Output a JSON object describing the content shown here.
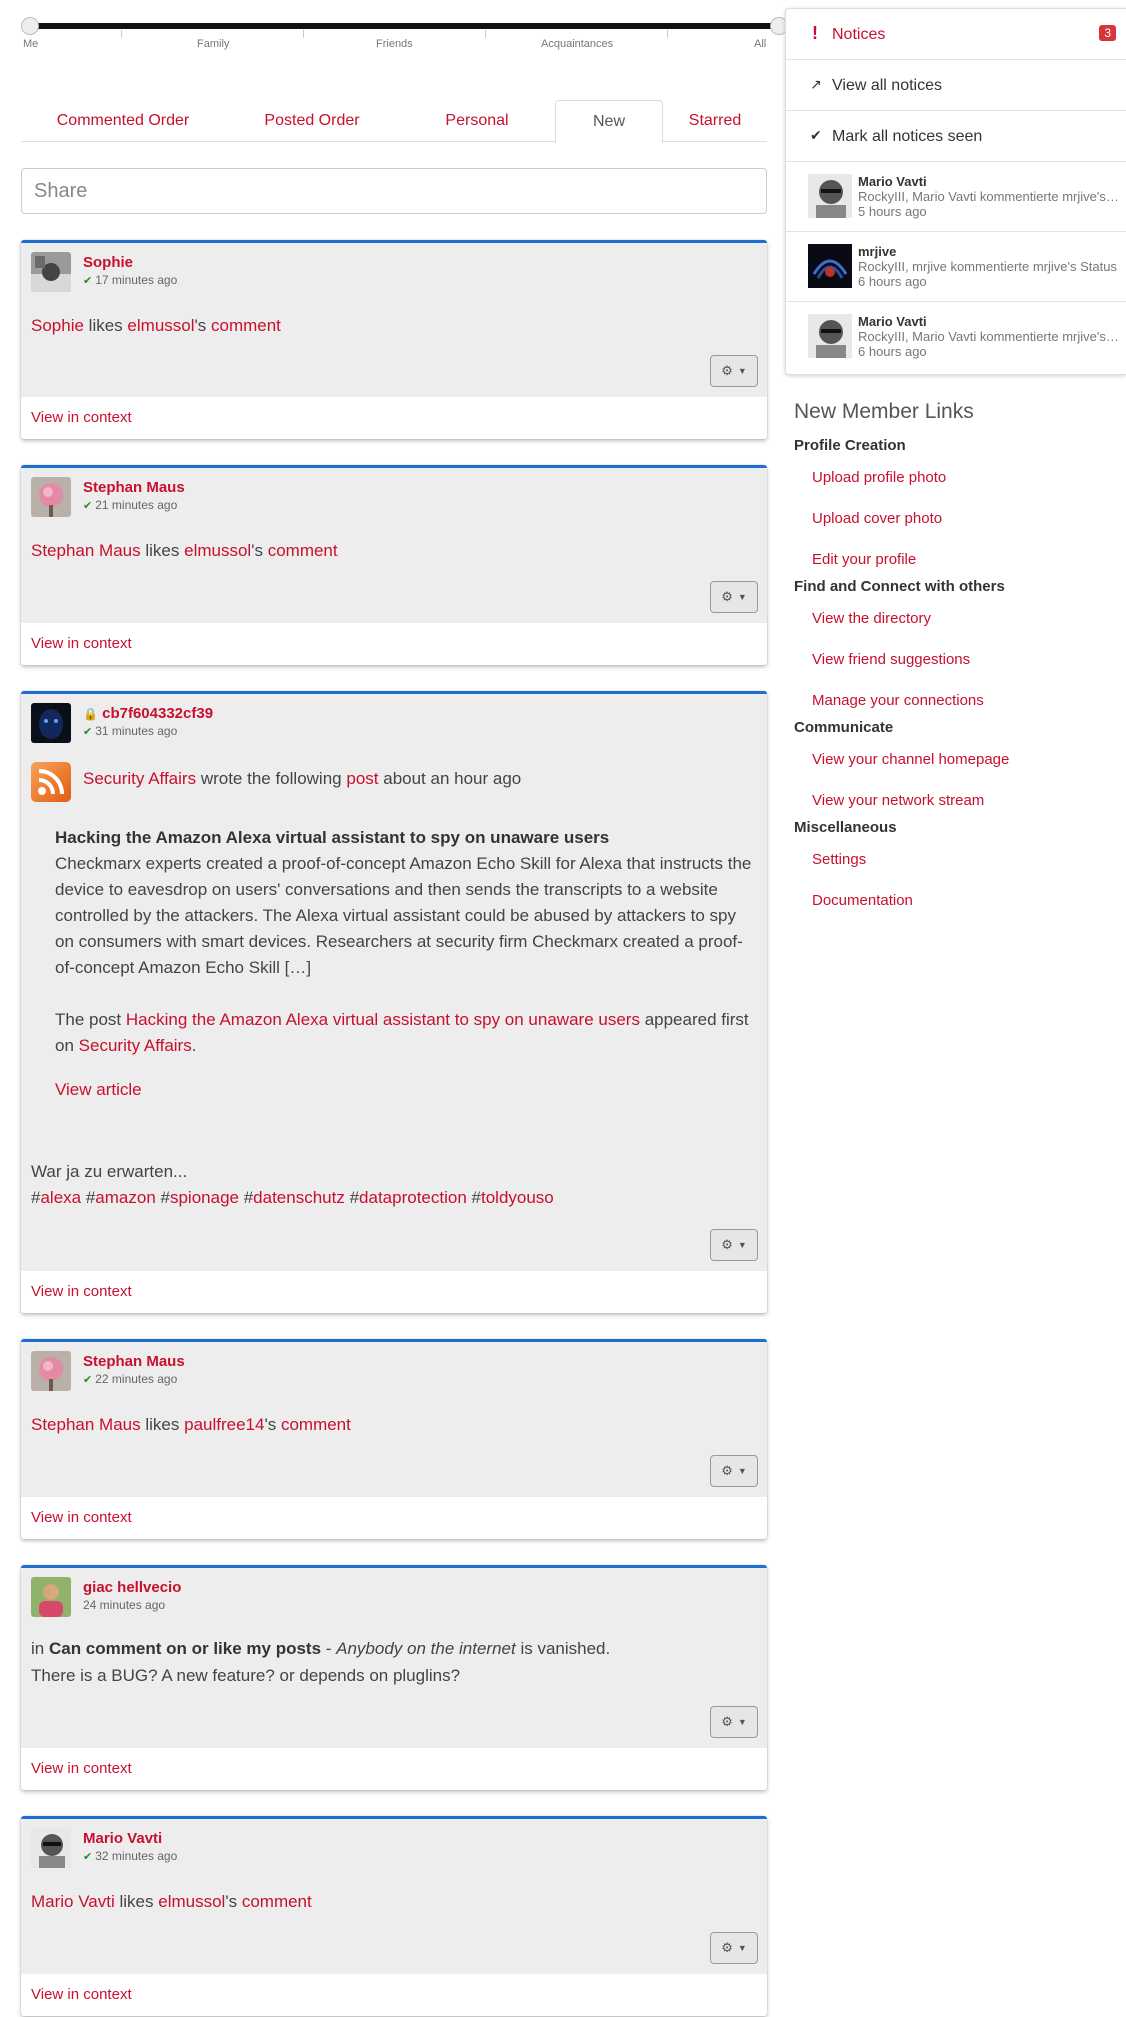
{
  "slider": {
    "labels": [
      "Me",
      "Family",
      "Friends",
      "Acquaintances",
      "All"
    ]
  },
  "tabs": [
    {
      "label": "Commented Order"
    },
    {
      "label": "Posted Order"
    },
    {
      "label": "Personal"
    },
    {
      "label": "New",
      "active": true
    },
    {
      "label": "Starred"
    }
  ],
  "share": {
    "placeholder": "Share"
  },
  "posts": {
    "p1": {
      "author": "Sophie",
      "time": "17 minutes ago",
      "actor": "Sophie",
      "verb": "likes",
      "target": "elmussol",
      "possessive": "'s",
      "object": "comment",
      "view_context": "View in context"
    },
    "p2": {
      "author": "Stephan Maus",
      "time": "21 minutes ago",
      "actor": "Stephan Maus",
      "verb": "likes",
      "target": "elmussol",
      "possessive": "'s",
      "object": "comment",
      "view_context": "View in context"
    },
    "p3": {
      "author": "cb7f604332cf39",
      "time": "31 minutes ago",
      "feed_source": "Security Affairs",
      "feed_mid": "wrote the following",
      "feed_post": "post",
      "feed_when": "about an hour ago",
      "headline": "Hacking the Amazon Alexa virtual assistant to spy on unaware users",
      "summary": "Checkmarx experts created a proof-of-concept Amazon Echo Skill for Alexa that instructs the device to eavesdrop on users' conversations and then sends the transcripts to a website controlled by the attackers. The Alexa virtual assistant could be abused by attackers to spy on consumers with smart devices. Researchers at security firm Checkmarx created a proof-of-concept Amazon Echo Skill […]",
      "the_post": "The post",
      "appeared": "appeared first on",
      "source_end": "Security Affairs",
      "view_article": "View article",
      "comment": "War ja zu erwarten...",
      "hashtags": [
        "alexa",
        "amazon",
        "spionage",
        "datenschutz",
        "dataprotection",
        "toldyouso"
      ],
      "view_context": "View in context"
    },
    "p4": {
      "author": "Stephan Maus",
      "time": "22 minutes ago",
      "actor": "Stephan Maus",
      "verb": "likes",
      "target": "paulfree14",
      "possessive": "'s",
      "object": "comment",
      "view_context": "View in context"
    },
    "p5": {
      "author": "giac hellvecio",
      "time": "24 minutes ago",
      "in": "in",
      "bold": "Can comment on or like my posts",
      "dash": " - ",
      "italic": "Anybody on the internet",
      "rest": "is vanished.",
      "line2": "There is a BUG? A new feature? or depends on pluglins?",
      "view_context": "View in context"
    },
    "p6": {
      "author": "Mario Vavti",
      "time": "32 minutes ago",
      "actor": "Mario Vavti",
      "verb": "likes",
      "target": "elmussol",
      "possessive": "'s",
      "object": "comment",
      "view_context": "View in context"
    }
  },
  "notices": {
    "title": "Notices",
    "count": "3",
    "view_all": "View all notices",
    "mark_seen": "Mark all notices seen",
    "items": [
      {
        "name": "Mario Vavti",
        "text": "RockyIII, Mario Vavti kommentierte mrjive's Status",
        "time": "5 hours ago"
      },
      {
        "name": "mrjive",
        "text": "RockyIII, mrjive kommentierte mrjive's Status",
        "time": "6 hours ago"
      },
      {
        "name": "Mario Vavti",
        "text": "RockyIII, Mario Vavti kommentierte mrjive's Status",
        "time": "6 hours ago"
      }
    ]
  },
  "member_links": {
    "title": "New Member Links",
    "cat1": "Profile Creation",
    "upload_photo": "Upload profile photo",
    "upload_cover": "Upload cover photo",
    "edit_profile": "Edit your profile",
    "cat2": "Find and Connect with others",
    "directory": "View the directory",
    "suggestions": "View friend suggestions",
    "connections": "Manage your connections",
    "cat3": "Communicate",
    "channel_home": "View your channel homepage",
    "network_stream": "View your network stream",
    "cat4": "Miscellaneous",
    "settings": "Settings",
    "documentation": "Documentation"
  },
  "colors": {
    "accent": "#c8102e",
    "card_border": "#1f6fd1",
    "card_bg": "#ededed",
    "check": "#2a8a2a"
  }
}
